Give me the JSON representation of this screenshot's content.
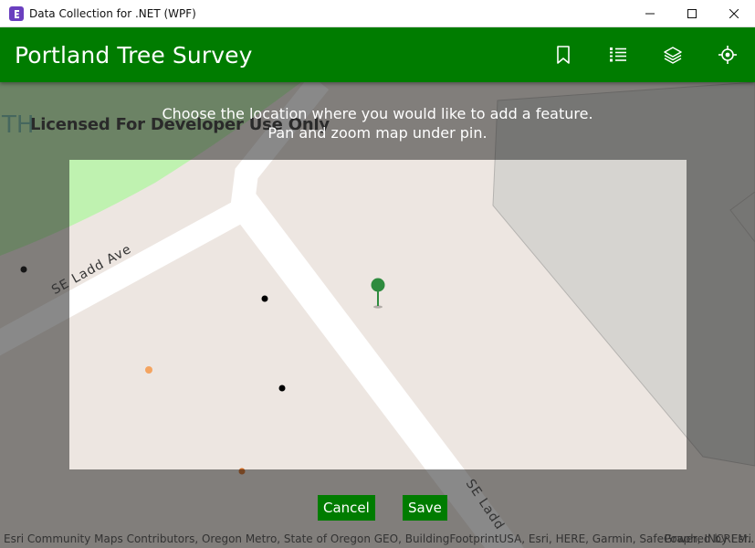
{
  "window": {
    "title": "Data Collection for .NET (WPF)",
    "icon": "app-logo-icon",
    "controls": [
      "minimize-icon",
      "maximize-icon",
      "close-icon"
    ]
  },
  "header": {
    "title": "Portland Tree Survey",
    "background_color": "#007c00",
    "icons": [
      "bookmark-icon",
      "list-icon",
      "layers-icon",
      "locate-icon"
    ]
  },
  "map": {
    "instruction_line1": "Choose the location where you would like to add a feature.",
    "instruction_line2": "Pan and zoom map under pin.",
    "license_text": "Licensed For Developer Use Only",
    "faded_label": "TH",
    "streets": {
      "ladd_ave": "SE Ladd Ave",
      "ladd": "SE Ladd"
    },
    "pin_color": "#2e8b3e"
  },
  "actions": {
    "cancel_label": "Cancel",
    "save_label": "Save"
  },
  "attribution": {
    "sources": "Esri Community Maps Contributors, Oregon Metro, State of Oregon GEO, BuildingFootprintUSA, Esri, HERE, Garmin, SafeGraph, INCREM...",
    "powered_by": "Powered by Esri"
  }
}
